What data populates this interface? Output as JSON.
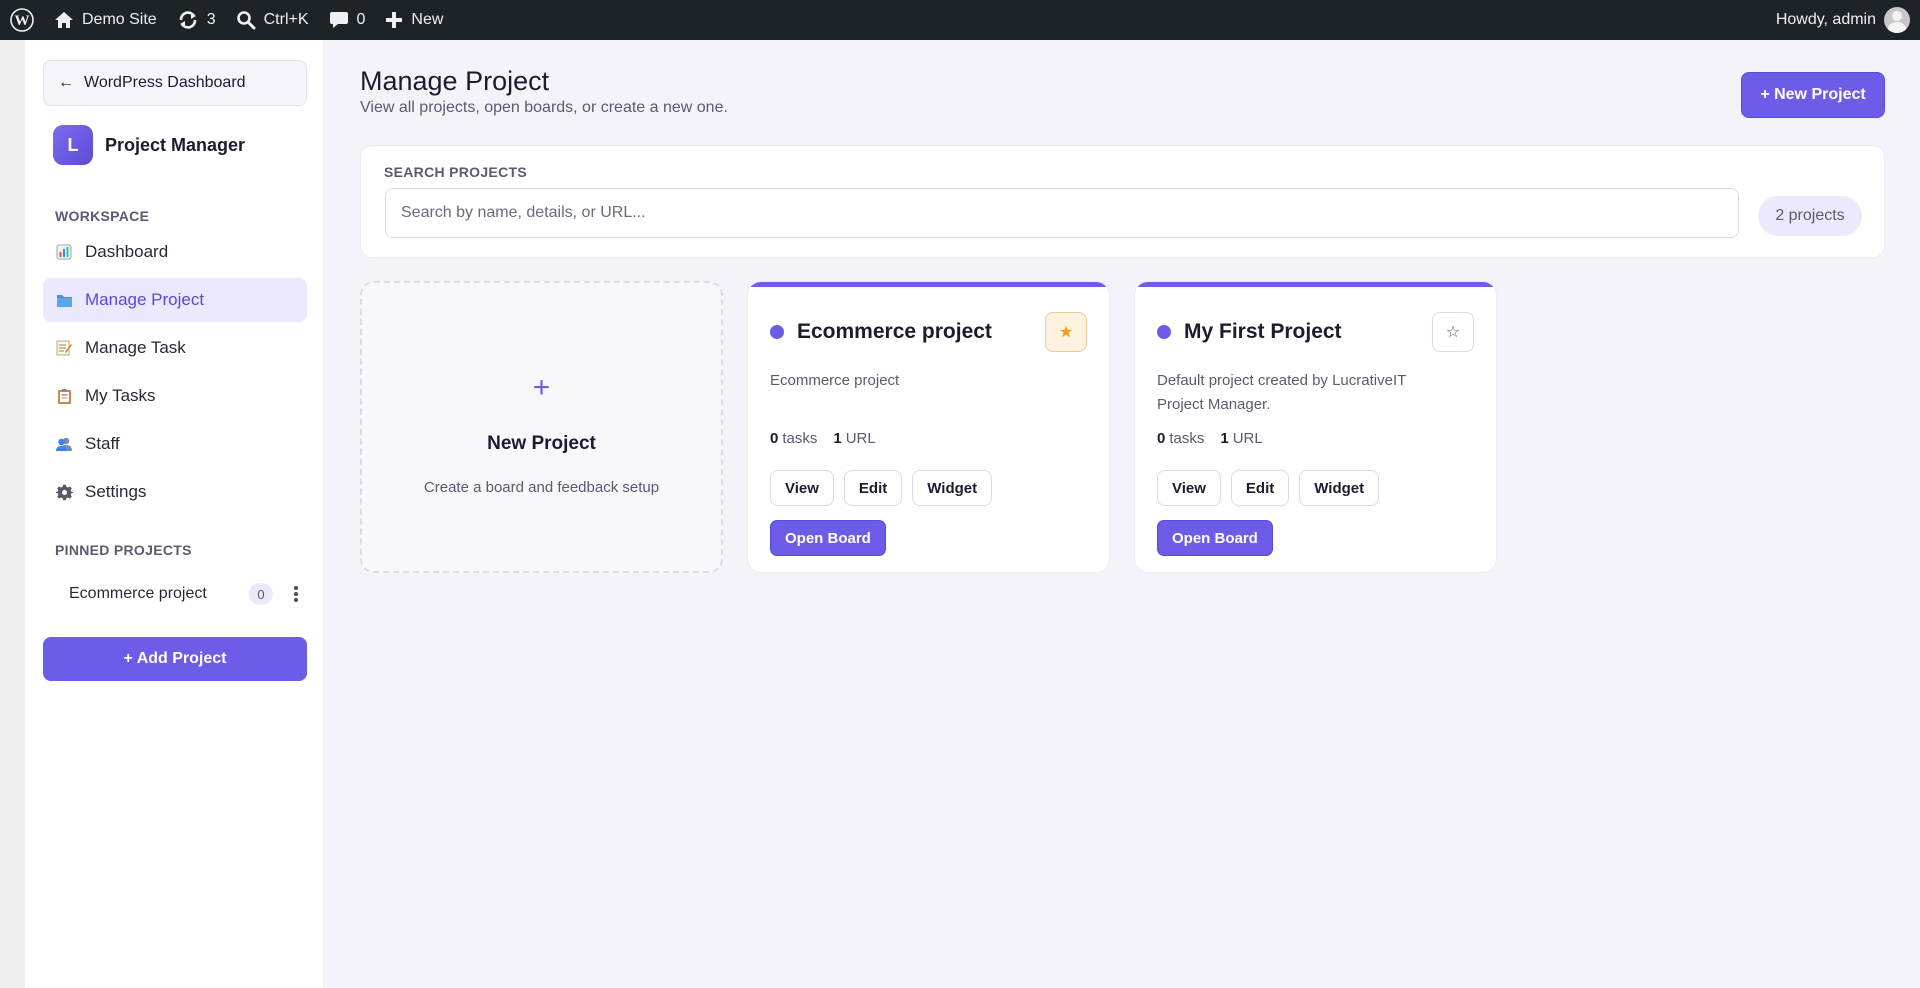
{
  "adminbar": {
    "site_name": "Demo Site",
    "updates_count": "3",
    "search_shortcut": "Ctrl+K",
    "comments_count": "0",
    "new_label": "New",
    "howdy": "Howdy, admin"
  },
  "sidebar": {
    "back_label": "WordPress Dashboard",
    "brand_letter": "L",
    "brand_name": "Project Manager",
    "workspace_title": "WORKSPACE",
    "items": [
      {
        "label": "Dashboard",
        "icon": "bar-chart-icon"
      },
      {
        "label": "Manage Project",
        "icon": "folder-icon",
        "active": true
      },
      {
        "label": "Manage Task",
        "icon": "memo-icon"
      },
      {
        "label": "My Tasks",
        "icon": "clipboard-icon"
      },
      {
        "label": "Staff",
        "icon": "people-icon"
      },
      {
        "label": "Settings",
        "icon": "gear-icon"
      }
    ],
    "pinned_title": "PINNED PROJECTS",
    "pinned": [
      {
        "name": "Ecommerce project",
        "count": "0"
      }
    ],
    "add_project_label": "+ Add Project"
  },
  "main": {
    "title": "Manage Project",
    "subtitle": "View all projects, open boards, or create a new one.",
    "new_project_label": "+ New Project",
    "search": {
      "label": "SEARCH PROJECTS",
      "placeholder": "Search by name, details, or URL...",
      "value": ""
    },
    "project_count": "2 projects",
    "new_card": {
      "plus": "+",
      "title": "New Project",
      "subtitle": "Create a board and feedback setup"
    },
    "projects": [
      {
        "name": "Ecommerce project",
        "description": "Ecommerce project",
        "starred": true,
        "star_glyph": "★",
        "tasks": "0",
        "tasks_label": "tasks",
        "urls": "1",
        "urls_label": "URL",
        "view_label": "View",
        "edit_label": "Edit",
        "widget_label": "Widget",
        "open_label": "Open Board"
      },
      {
        "name": "My First Project",
        "description": "Default project created by LucrativeIT Project Manager.",
        "starred": false,
        "star_glyph": "☆",
        "tasks": "0",
        "tasks_label": "tasks",
        "urls": "1",
        "urls_label": "URL",
        "view_label": "View",
        "edit_label": "Edit",
        "widget_label": "Widget",
        "open_label": "Open Board"
      }
    ]
  },
  "colors": {
    "accent": "#6c5ce7",
    "adminbar": "#1d2327",
    "star_on": "#f39c12"
  }
}
